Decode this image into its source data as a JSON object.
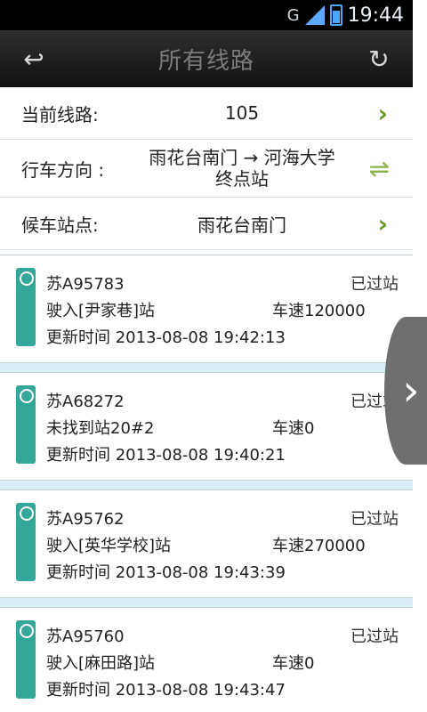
{
  "status_bar": {
    "network": "G",
    "time": "19:44"
  },
  "title_bar": {
    "title": "所有线路",
    "back_icon": "back-icon",
    "refresh_icon": "refresh-icon"
  },
  "info": {
    "route_label": "当前线路:",
    "route_value": "105",
    "direction_label": "行车方向 :",
    "direction_value_line1": "雨花台南门 → 河海大学",
    "direction_value_line2": "终点站",
    "station_label": "候车站点:",
    "station_value": "雨花台南门",
    "arrow_icon": "chevron-right-icon",
    "swap_icon": "swap-icon"
  },
  "buses": [
    {
      "plate": "苏A95783",
      "status": "已过站",
      "arrival": "驶入[尹家巷]站",
      "speed": "车速120000",
      "update_time": "更新时间 2013-08-08 19:42:13"
    },
    {
      "plate": "苏A68272",
      "status": "已过站",
      "arrival": "未找到站20#2",
      "speed": "车速0",
      "update_time": "更新时间 2013-08-08 19:40:21"
    },
    {
      "plate": "苏A95762",
      "status": "已过站",
      "arrival": "驶入[英华学校]站",
      "speed": "车速270000",
      "update_time": "更新时间 2013-08-08 19:43:39"
    },
    {
      "plate": "苏A95760",
      "status": "已过站",
      "arrival": "驶入[麻田路]站",
      "speed": "车速0",
      "update_time": "更新时间 2013-08-08 19:43:47"
    }
  ]
}
